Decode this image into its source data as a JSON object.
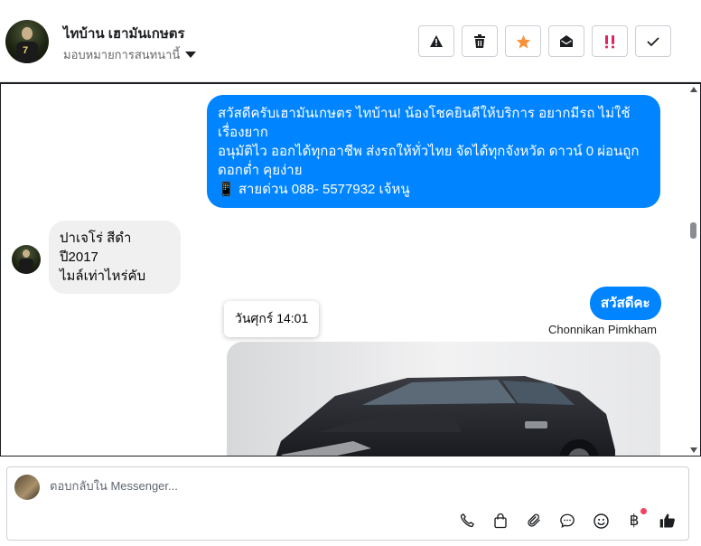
{
  "header": {
    "contact_name": "ไทบ้าน เฮามันเกษตร",
    "assign_label": "มอบหมายการสนทนานี้"
  },
  "actions": [
    {
      "name": "report-spam-button",
      "icon": "warning-icon"
    },
    {
      "name": "delete-button",
      "icon": "trash-icon"
    },
    {
      "name": "star-button",
      "icon": "star-icon",
      "color": "#f7923b"
    },
    {
      "name": "mark-unread-button",
      "icon": "envelope-open-icon"
    },
    {
      "name": "follow-up-button",
      "icon": "double-exclamation-icon",
      "color": "#e0245e"
    },
    {
      "name": "mark-done-button",
      "icon": "check-icon"
    }
  ],
  "messages": {
    "outgoing_1": {
      "lines": [
        "สวัสดีครับเฮามันเกษตร ไทบ้าน! น้องโชคยินดีให้บริการ อยากมีรถ ไม่ใช้เรื่องยาก",
        "อนุมัติไว ออกได้ทุกอาชีพ ส่งรถให้ทั่วไทย จัดได้ทุกจังหวัด ดาวน์ 0  ผ่อนถูก ดอกต่ำ คุยง่าย",
        "📱 สายด่วน 088- 5577932 เจ้หนู"
      ]
    },
    "incoming_1": {
      "lines": [
        "ปาเจโร่ สีดำปี2017",
        "ไมล์เท่าไหร่คับ"
      ]
    },
    "outgoing_2": {
      "text": "สวัสดีคะ"
    },
    "sender_name": "Chonnikan Pimkham",
    "timestamp_tooltip": "วันศุกร์ 14:01"
  },
  "composer": {
    "placeholder": "ตอบกลับใน Messenger...",
    "tools": [
      "phone-icon",
      "shopping-bag-icon",
      "paperclip-icon",
      "chat-bubble-icon",
      "smiley-icon",
      "baht-icon",
      "thumbs-up-icon"
    ],
    "baht_symbol": "฿"
  },
  "colors": {
    "outgoing_bubble": "#0084ff",
    "incoming_bubble": "#f0f0f0",
    "star": "#f7923b",
    "follow_up": "#e0245e",
    "notification_dot": "#f3425f"
  }
}
